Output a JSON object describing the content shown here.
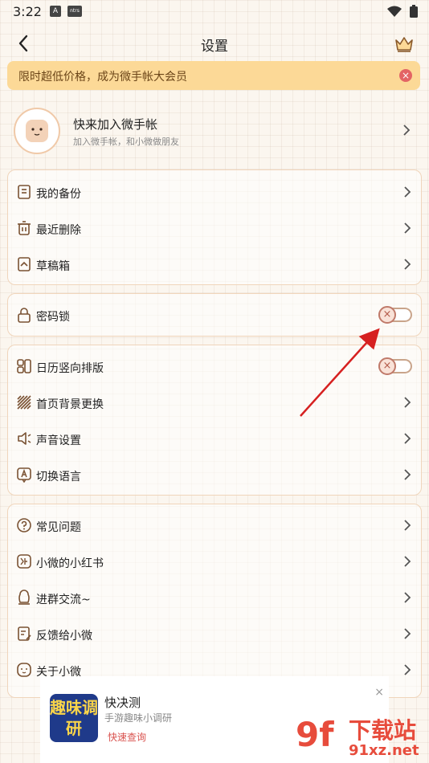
{
  "status": {
    "time": "3:22",
    "icon1": "A",
    "icon2": "ntrs"
  },
  "header": {
    "title": "设置"
  },
  "banner": {
    "text": "限时超低价格，成为微手帐大会员"
  },
  "profile": {
    "name": "快来加入微手帐",
    "subtitle": "加入微手帐，和小微做朋友"
  },
  "groups": {
    "data": [
      {
        "label": "我的备份",
        "icon": "backup-icon"
      },
      {
        "label": "最近删除",
        "icon": "trash-icon"
      },
      {
        "label": "草稿箱",
        "icon": "drafts-icon"
      }
    ],
    "lock": {
      "label": "密码锁",
      "icon": "lock-icon",
      "toggle": "off"
    },
    "display": [
      {
        "label": "日历竖向排版",
        "icon": "calendar-layout-icon",
        "toggle": "off"
      },
      {
        "label": "首页背景更换",
        "icon": "background-icon"
      },
      {
        "label": "声音设置",
        "icon": "sound-icon"
      },
      {
        "label": "切换语言",
        "icon": "language-icon"
      }
    ],
    "help": [
      {
        "label": "常见问题",
        "icon": "question-icon"
      },
      {
        "label": "小微的小红书",
        "icon": "xiaohongshu-icon"
      },
      {
        "label": "进群交流~",
        "icon": "group-chat-icon"
      },
      {
        "label": "反馈给小微",
        "icon": "feedback-icon"
      },
      {
        "label": "关于小微",
        "icon": "about-icon"
      }
    ]
  },
  "ad": {
    "logo": "趣味调研",
    "title": "快决测",
    "subtitle": "手游趣味小调研",
    "link": "快速查询",
    "close": "×"
  },
  "watermark": {
    "mark": "9f",
    "text1": "下载站",
    "text2": "91xz.net"
  },
  "colors": {
    "accent": "#f0d5bb",
    "banner": "#fcd997",
    "arrow": "#d62020"
  }
}
